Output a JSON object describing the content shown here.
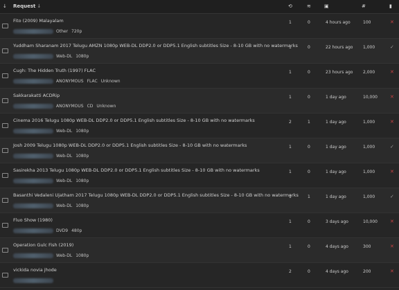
{
  "header": {
    "request_label": "Request",
    "sort_glyph": "↓",
    "icons": {
      "category": "sort-icon",
      "seeders": "seeders-icon",
      "leechers": "leechers-icon",
      "age": "calendar-icon",
      "size": "hash-icon",
      "status": "signal-icon"
    }
  },
  "rows": [
    {
      "title": "Fito (2009) Malayalam",
      "meta": [
        "Other",
        "720p"
      ],
      "seeders": "1",
      "leechers": "0",
      "age": "4 hours ago",
      "size": "100",
      "status": "✕",
      "status_kind": "x",
      "cat_icon": "film-icon"
    },
    {
      "title": "Yuddham Sharanam 2017 Telugu AMZN 1080p WEB-DL DDP2.0 or DDP5.1 English subtitles Size - 8-10 GB with no watermarks",
      "meta": [
        "Web-DL",
        "1080p"
      ],
      "seeders": "1",
      "leechers": "0",
      "age": "22 hours ago",
      "size": "1,000",
      "status": "✓",
      "status_kind": "ok",
      "cat_icon": "film-icon"
    },
    {
      "title": "Cugh: The Hidden Truth (1997) FLAC",
      "meta": [
        "ANONYMOUS",
        "FLAC",
        "Unknown"
      ],
      "seeders": "1",
      "leechers": "0",
      "age": "23 hours ago",
      "size": "2,000",
      "status": "✕",
      "status_kind": "x",
      "cat_icon": "music-icon"
    },
    {
      "title": "Sakkarakatti ACDRip",
      "meta": [
        "ANONYMOUS",
        "CD",
        "Unknown"
      ],
      "seeders": "1",
      "leechers": "0",
      "age": "1 day ago",
      "size": "10,000",
      "status": "✕",
      "status_kind": "x",
      "cat_icon": "music-icon"
    },
    {
      "title": "Cinema 2016 Telugu 1080p WEB-DL DDP2.0 or DDP5.1 English subtitles Size - 8-10 GB with no watermarks",
      "meta": [
        "Web-DL",
        "1080p"
      ],
      "seeders": "2",
      "leechers": "1",
      "age": "1 day ago",
      "size": "1,000",
      "status": "✕",
      "status_kind": "x",
      "cat_icon": "film-icon"
    },
    {
      "title": "Josh 2009 Telugu 1080p WEB-DL DDP2.0 or DDP5.1 English subtitles Size - 8-10 GB with no watermarks",
      "meta": [
        "Web-DL",
        "1080p"
      ],
      "seeders": "1",
      "leechers": "0",
      "age": "1 day ago",
      "size": "1,000",
      "status": "✓",
      "status_kind": "ok",
      "cat_icon": "film-icon"
    },
    {
      "title": "Sasirekha 2013 Telugu 1080p WEB-DL DDP2.0 or DDP5.1 English subtitles Size - 8-10 GB with no watermarks",
      "meta": [
        "Web-DL",
        "1080p"
      ],
      "seeders": "1",
      "leechers": "0",
      "age": "1 day ago",
      "size": "1,000",
      "status": "✕",
      "status_kind": "x",
      "cat_icon": "film-icon"
    },
    {
      "title": "Basanthi Vedaleni Ujatham 2017 Telugu 1080p WEB-DL DDP2.0 or DDP5.1 English subtitles Size - 8-10 GB with no watermarks",
      "meta": [
        "Web-DL",
        "1080p"
      ],
      "seeders": "1",
      "leechers": "1",
      "age": "1 day ago",
      "size": "1,000",
      "status": "✓",
      "status_kind": "ok",
      "cat_icon": "film-icon"
    },
    {
      "title": "Fluo Show (1980)",
      "meta": [
        "DVD9",
        "480p"
      ],
      "seeders": "1",
      "leechers": "0",
      "age": "3 days ago",
      "size": "10,000",
      "status": "✕",
      "status_kind": "x",
      "cat_icon": "tv-icon"
    },
    {
      "title": "Operation Gulc Fish (2019)",
      "meta": [
        "Web-DL",
        "1080p"
      ],
      "seeders": "1",
      "leechers": "0",
      "age": "4 days ago",
      "size": "300",
      "status": "✕",
      "status_kind": "x",
      "cat_icon": "film-icon"
    },
    {
      "title": "vickida novia jhode",
      "meta": [],
      "seeders": "2",
      "leechers": "0",
      "age": "4 days ago",
      "size": "200",
      "status": "✕",
      "status_kind": "x",
      "cat_icon": "film-icon"
    }
  ]
}
